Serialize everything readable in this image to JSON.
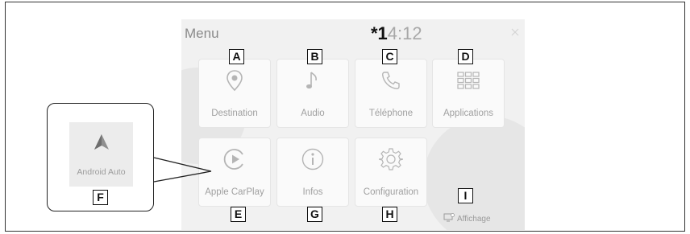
{
  "screen": {
    "menu_title": "Menu",
    "clock": {
      "marker": "*1",
      "time": "4:12"
    },
    "tiles": [
      {
        "label": "Destination",
        "icon": "map-pin-icon",
        "callout": "A"
      },
      {
        "label": "Audio",
        "icon": "music-note-icon",
        "callout": "B"
      },
      {
        "label": "Téléphone",
        "icon": "phone-icon",
        "callout": "C"
      },
      {
        "label": "Applications",
        "icon": "app-grid-icon",
        "callout": "D"
      },
      {
        "label": "Apple CarPlay",
        "icon": "carplay-icon",
        "callout": "E"
      },
      {
        "label": "Infos",
        "icon": "info-icon",
        "callout": "G"
      },
      {
        "label": "Configuration",
        "icon": "gear-icon",
        "callout": "H"
      }
    ],
    "display_button": {
      "label": "Affichage",
      "icon": "display-icon",
      "callout": "I"
    }
  },
  "callout_box": {
    "label": "Android Auto",
    "icon": "android-auto-icon",
    "callout": "F"
  },
  "colors": {
    "screen_bg": "#f1f1f1",
    "tile_bg": "#fafafa",
    "icon": "#b5b5b5",
    "frame": "#333333"
  }
}
